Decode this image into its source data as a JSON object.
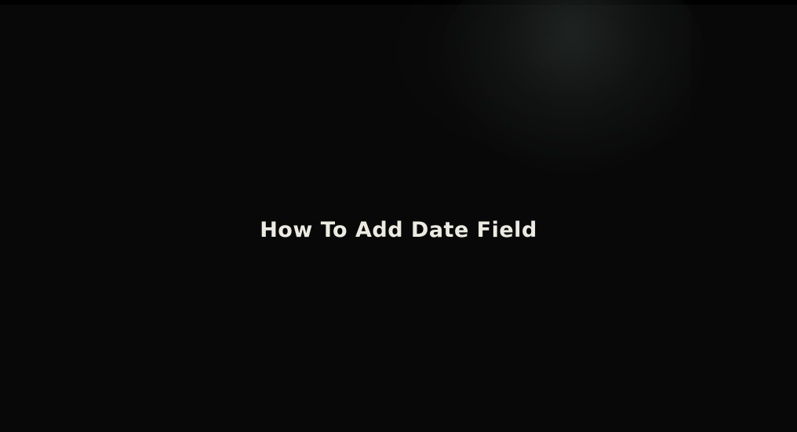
{
  "title": "How To Add Date Field",
  "colors": {
    "background": "#080808",
    "title_text": "#ecebe2"
  }
}
